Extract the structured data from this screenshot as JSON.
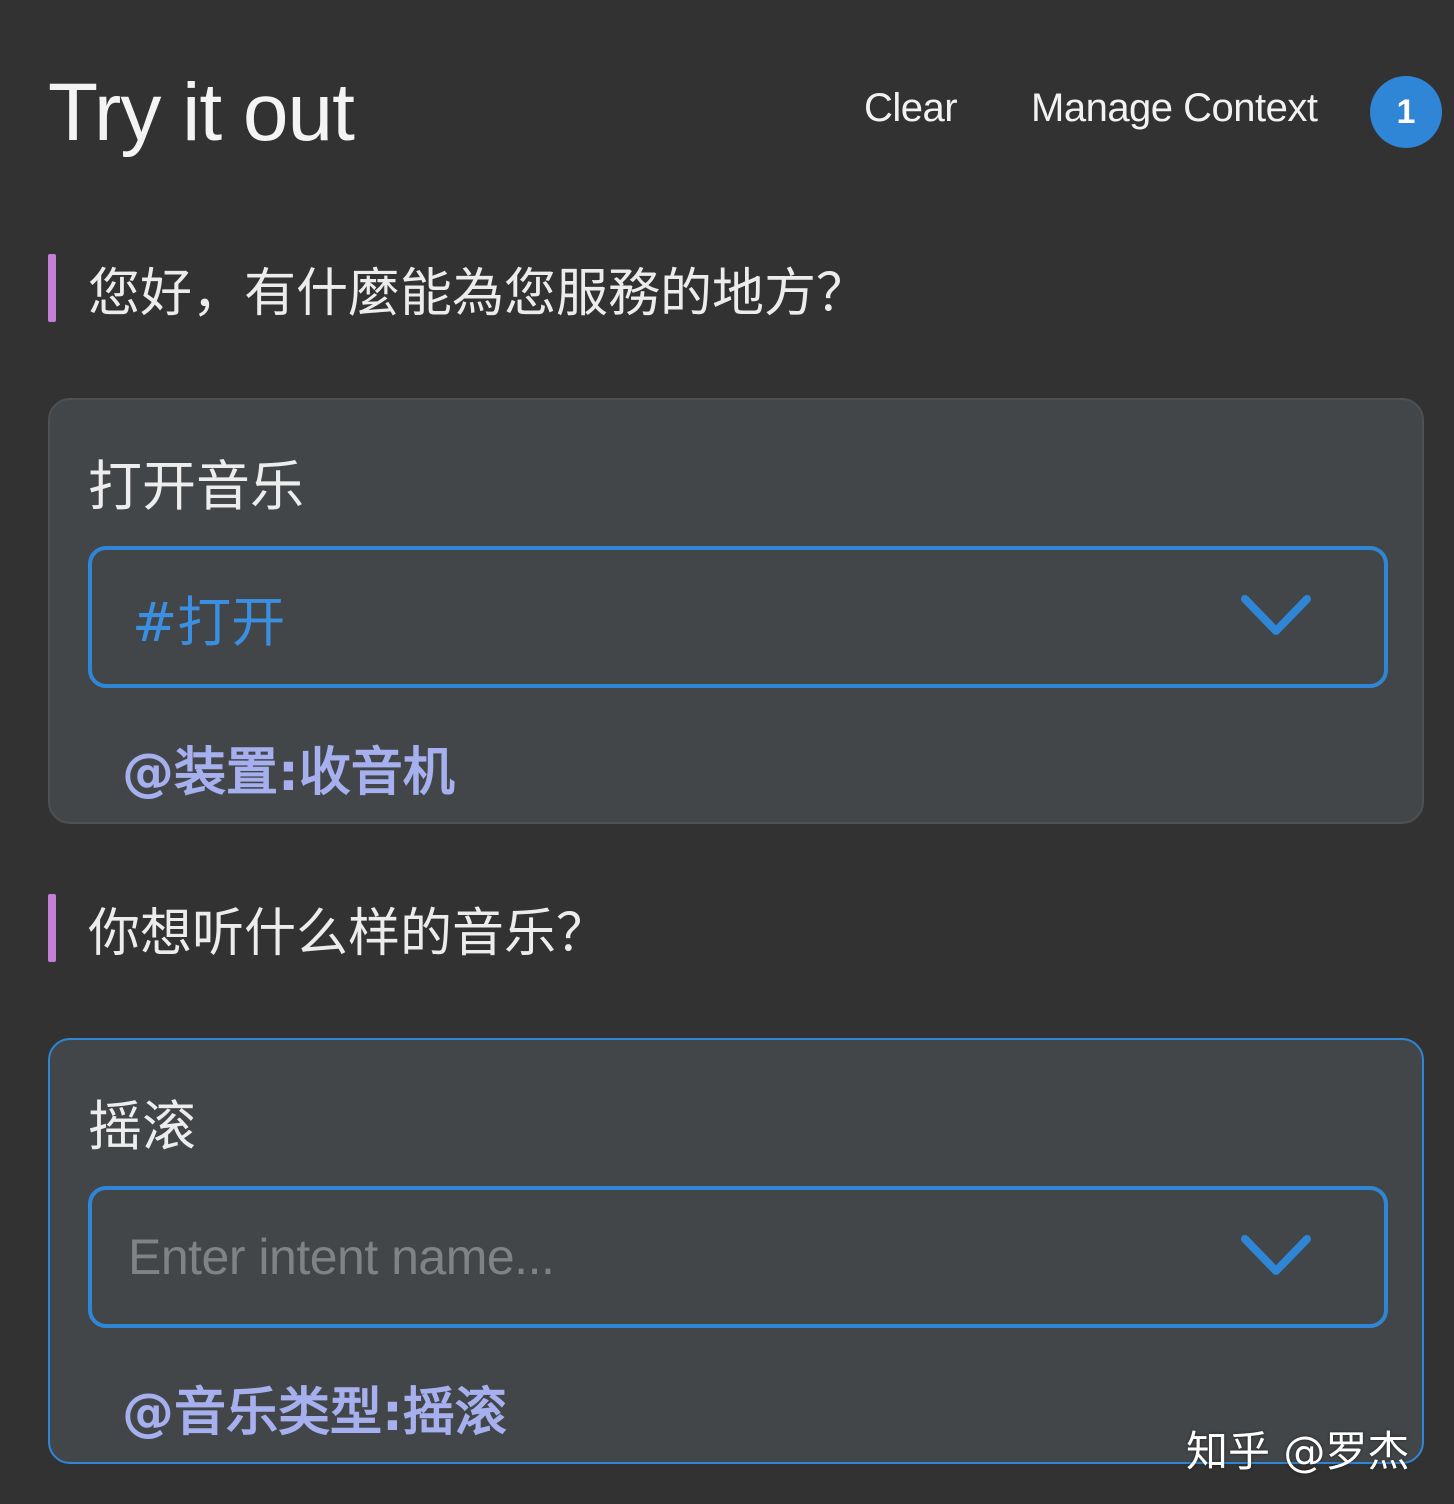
{
  "header": {
    "title": "Try it out",
    "clear_label": "Clear",
    "manage_context_label": "Manage Context",
    "context_count": "1"
  },
  "conversation": [
    {
      "bot_message": "您好，有什麼能為您服務的地方？",
      "user_input": "打开音乐",
      "intent_value": "#打开",
      "intent_placeholder": "",
      "entity": "@装置:收音机"
    },
    {
      "bot_message": "你想听什么样的音乐？",
      "user_input": "摇滚",
      "intent_value": "",
      "intent_placeholder": "Enter intent name...",
      "entity": "@音乐类型:摇滚"
    }
  ],
  "watermark": "知乎 @罗杰",
  "colors": {
    "background": "#323233",
    "card": "#434648",
    "accent_blue": "#2f86d7",
    "bot_bar": "#c47fd6",
    "entity_text": "#a6b0ee"
  },
  "icons": {
    "dropdown": "chevron-down-icon"
  }
}
